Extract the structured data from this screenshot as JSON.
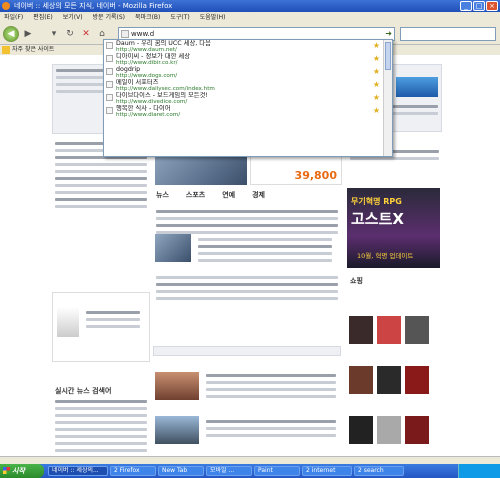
{
  "window": {
    "title": "네이버 :: 세상의 모든 지식, 네이버 - Mozilla Firefox"
  },
  "menu": [
    "파일(F)",
    "편집(E)",
    "보기(V)",
    "방문 기록(S)",
    "북마크(B)",
    "도구(T)",
    "도움말(H)"
  ],
  "address": {
    "value": "www.d"
  },
  "bookmarks": {
    "first": "자주 찾은 사이트"
  },
  "autocomplete": [
    {
      "title": "Daum - 우리 꿈의 UCC 세상, 다음",
      "url": "http://www.daum.net/"
    },
    {
      "title": "디아이씨 - 정보가 대한 세상",
      "url": "http://www.dibir.co.kr/"
    },
    {
      "title": "dogdrip",
      "url": "http://www.dogs.com/"
    },
    {
      "title": "메일이 서포터즈",
      "url": "http://www.dailysec.com/index.htm"
    },
    {
      "title": "다이브다이스 - 보드게임의 모든것!",
      "url": "http://www.divedice.com/"
    },
    {
      "title": "행복한 식사 - 다이어",
      "url": "http://www.diaret.com/"
    }
  ],
  "page": {
    "ad_left": "39,800",
    "ad_right_l1": "무기혁명 RPG",
    "ad_right_l2": "고스트X",
    "ad_right_l3": "10월, 혁명 업데이트",
    "tabs_news": [
      "뉴스",
      "스포츠",
      "연예",
      "경제"
    ],
    "section_recent": "실시간 뉴스 검색어",
    "section_shopping": "쇼핑"
  },
  "taskbar": {
    "start": "시작",
    "tasks": [
      "네이버 :: 세상의...",
      "2 Firefox",
      "New Tab",
      "모바일 ...",
      "Paint",
      "2 internet",
      "2 search"
    ]
  }
}
